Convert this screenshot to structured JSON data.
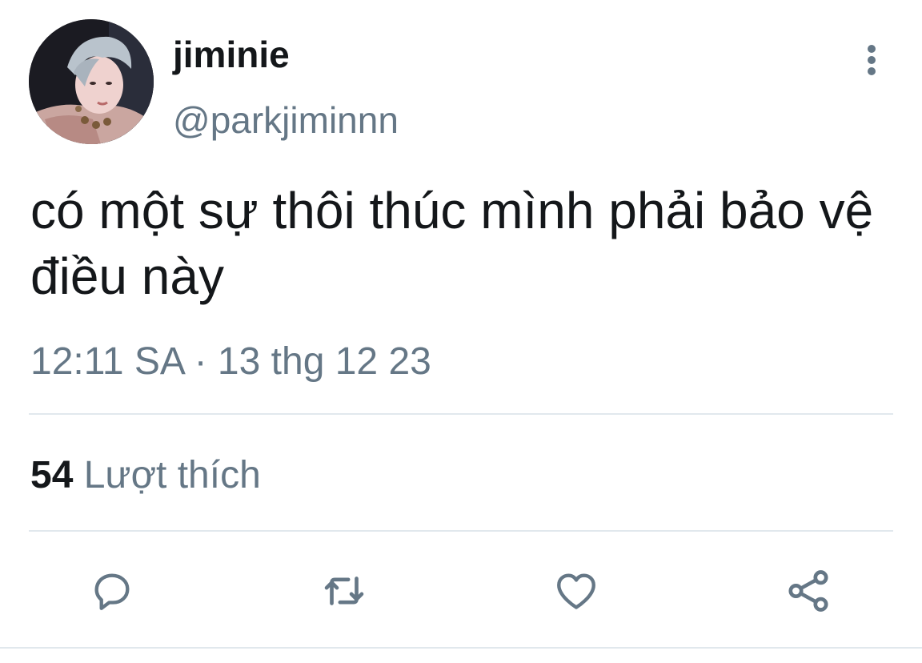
{
  "user": {
    "display_name": "jiminie",
    "handle": "@parkjiminnn",
    "avatar_icon": "profile-photo"
  },
  "tweet": {
    "text": "có một sự thôi thúc mình phải bảo vệ điều này",
    "timestamp": "12:11 SA · 13 thg 12 23"
  },
  "stats": {
    "likes_count": "54",
    "likes_label": "Lượt thích"
  },
  "actions": {
    "more_icon": "more-vertical-icon",
    "reply_icon": "reply-icon",
    "retweet_icon": "retweet-icon",
    "like_icon": "heart-icon",
    "share_icon": "share-icon"
  },
  "colors": {
    "text_primary": "#14171a",
    "text_secondary": "#657786",
    "divider": "#e1e8ed"
  }
}
